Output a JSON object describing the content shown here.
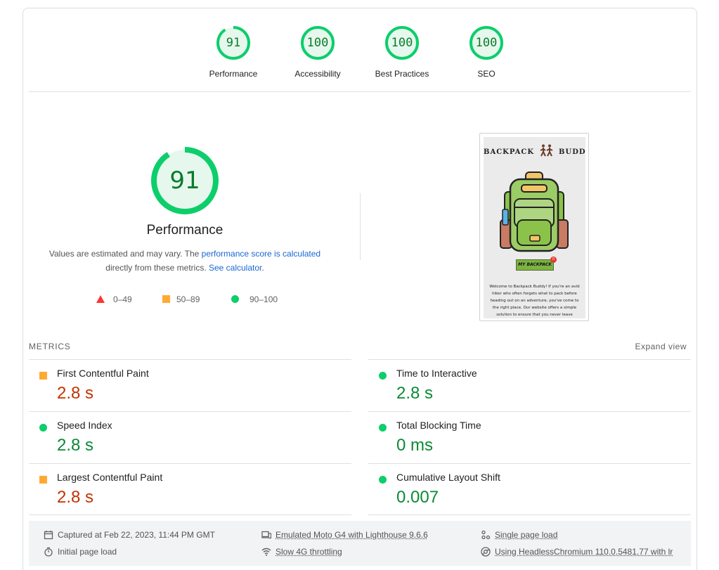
{
  "gauges": [
    {
      "score": "91",
      "label": "Performance",
      "fraction": 0.91
    },
    {
      "score": "100",
      "label": "Accessibility",
      "fraction": 1.0
    },
    {
      "score": "100",
      "label": "Best Practices",
      "fraction": 1.0
    },
    {
      "score": "100",
      "label": "SEO",
      "fraction": 1.0
    }
  ],
  "performance": {
    "score": "91",
    "fraction": 0.91,
    "title": "Performance",
    "desc_before": "Values are estimated and may vary. The ",
    "desc_link1": "performance score is calculated",
    "desc_middle": "directly from these metrics. ",
    "desc_link2": "See calculator",
    "desc_end": "."
  },
  "legend": {
    "fail": "0–49",
    "average": "50–89",
    "pass": "90–100"
  },
  "thumbnail": {
    "brand_left": "BACKPACK",
    "brand_right": "BUDDY",
    "button": "MY BACKPACK",
    "badge": "0",
    "blurb": "Welcome to Backpack Buddy! If you're an avid hiker who often forgets what to pack before heading out on an adventure, you've come to the right place. Our website offers a simple solution to ensure that you never leave anything behind"
  },
  "metrics": {
    "header": "METRICS",
    "expand": "Expand view",
    "items": [
      {
        "name": "First Contentful Paint",
        "value": "2.8 s",
        "status": "average"
      },
      {
        "name": "Time to Interactive",
        "value": "2.8 s",
        "status": "pass"
      },
      {
        "name": "Speed Index",
        "value": "2.8 s",
        "status": "pass"
      },
      {
        "name": "Total Blocking Time",
        "value": "0 ms",
        "status": "pass"
      },
      {
        "name": "Largest Contentful Paint",
        "value": "2.8 s",
        "status": "average"
      },
      {
        "name": "Cumulative Layout Shift",
        "value": "0.007",
        "status": "pass"
      }
    ]
  },
  "footer": {
    "captured": "Captured at Feb 22, 2023, 11:44 PM GMT",
    "initial": "Initial page load",
    "device": "Emulated Moto G4 with Lighthouse 9.6.6",
    "throttling": "Slow 4G throttling",
    "single": "Single page load",
    "browser": "Using HeadlessChromium 110.0.5481.77 with lr"
  },
  "colors": {
    "pass": "#0cce6b",
    "pass_text": "#0b8a35",
    "average": "#ffaa33",
    "average_text": "#c33300",
    "fail": "#ff3333",
    "link": "#1967d2"
  }
}
